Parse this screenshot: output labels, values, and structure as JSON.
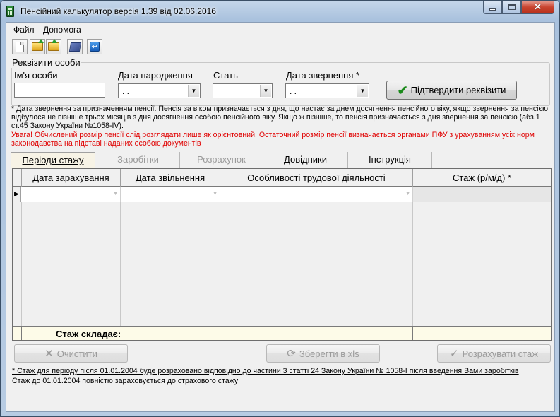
{
  "window": {
    "title": "Пенсійний калькулятор версія 1.39 від 02.06.2016"
  },
  "menu": {
    "items": [
      "Файл",
      "Допомога"
    ]
  },
  "toolbar": {
    "icons": [
      "new-document-icon",
      "open-folder-icon",
      "save-folder-icon",
      "reference-book-icon",
      "exit-icon"
    ]
  },
  "person": {
    "legend": "Реквізити особи",
    "name_label": "Ім'я особи",
    "name_value": "",
    "birth_label": "Дата народження",
    "birth_value": " .  .",
    "gender_label": "Стать",
    "gender_value": "",
    "request_label": "Дата звернення *",
    "request_value": " .  .",
    "confirm_button": "Підтвердити реквізити"
  },
  "notes": {
    "note1": "* Дата звернення за призначенням пенсії. Пенсія за віком призначається з дня, що настає за днем досягнення пенсійного віку, якщо звернення за пенсією відбулося не пізніше трьох місяців з дня досягнення особою пенсійного віку. Якщо ж пізніше, то пенсія призначається з дня звернення за пенсією (абз.1 ст.45 Закону України №1058-IV).",
    "warning": "Увага! Обчислений розмір пенсії слід розглядати лише як орієнтовний. Остаточний розмір пенсії визначається органами ПФУ з урахуванням усіх норм законодавства на підставі наданих особою документів"
  },
  "tabs": [
    {
      "label": "Періоди стажу",
      "state": "active"
    },
    {
      "label": "Заробітки",
      "state": "disabled"
    },
    {
      "label": "Розрахунок",
      "state": "disabled"
    },
    {
      "label": "Довідники",
      "state": "enabled"
    },
    {
      "label": "Інструкція",
      "state": "enabled"
    }
  ],
  "grid": {
    "columns": [
      "Дата зарахування",
      "Дата звільнення",
      "Особливості трудової діяльності",
      "Стаж (р/м/д) *"
    ],
    "row_indicator": "▶",
    "footer_label": "Стаж складає:"
  },
  "buttons": {
    "clear": "Очистити",
    "save_xls": "Зберегти в xls",
    "calculate": "Розрахувати стаж"
  },
  "footer": {
    "note1": "* Стаж для періоду після 01.01.2004 буде розраховано відповідно до частини 3 статті 24 Закону України № 1058-І після введення Вами заробітків",
    "note2": "Стаж до 01.01.2004 повністю зараховується до страхового стажу"
  },
  "colors": {
    "active_tab_bg": "#f7f3e6",
    "footer_row_bg": "#fdfbe8",
    "warning_text": "#e00000",
    "confirm_check": "#1a8a1a",
    "titlebar_bg": "#b8cce3",
    "close_button": "#c94530"
  }
}
